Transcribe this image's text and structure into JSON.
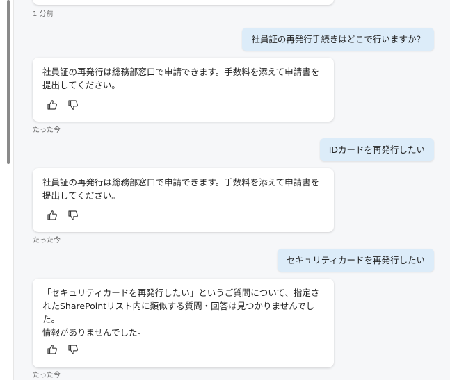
{
  "chat": {
    "top_timestamp": "1 分前",
    "messages": [
      {
        "user_text": "社員証の再発行手続きはどこで行いますか？",
        "bot_text": "社員証の再発行は総務部窓口で申請できます。手数料を添えて申請書を\n提出してください。",
        "timestamp": "たった今"
      },
      {
        "user_text": "IDカードを再発行したい",
        "bot_text": "社員証の再発行は総務部窓口で申請できます。手数料を添えて申請書を\n提出してください。",
        "timestamp": "たった今"
      },
      {
        "user_text": "セキュリティカードを再発行したい",
        "bot_text": "「セキュリティカードを再発行したい」というご質問について、指定さ\nれたSharePointリスト内に類似する質問・回答は見つかりませんでし\nた。\n情報がありませんでした。",
        "timestamp": "たった今"
      }
    ]
  },
  "icons": {
    "like": "thumbs-up-icon",
    "dislike": "thumbs-down-icon"
  },
  "colors": {
    "user_bubble": "#dcecf9",
    "bot_card": "#ffffff",
    "background": "#f6f7f9"
  }
}
